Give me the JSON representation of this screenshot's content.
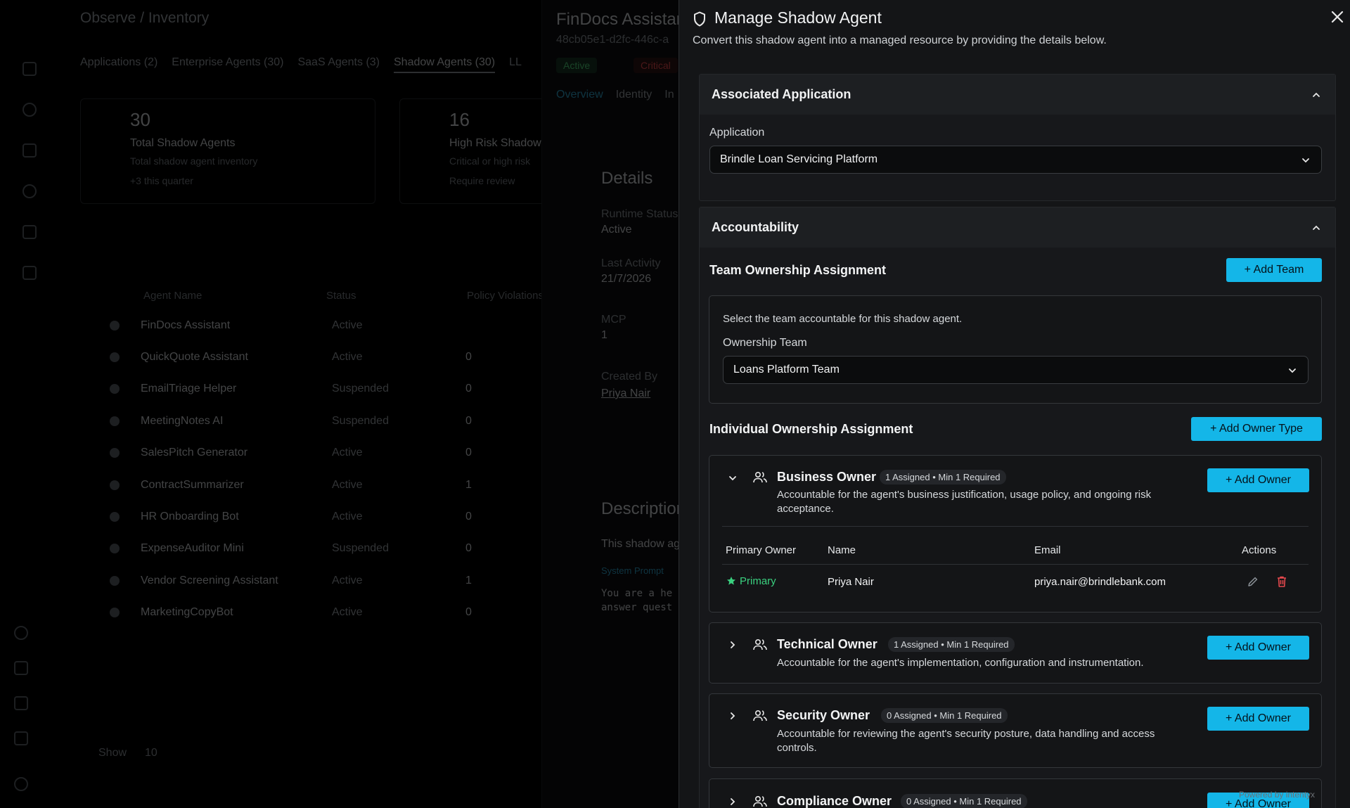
{
  "background": {
    "breadcrumb": "Observe  /  Inventory",
    "tabs": [
      "Applications (2)",
      "Enterprise Agents (30)",
      "SaaS Agents (3)",
      "Shadow Agents (30)",
      "LL"
    ],
    "stats": [
      {
        "value": "30",
        "title": "Total Shadow Agents",
        "line1": "Total shadow agent inventory",
        "line2": "+3 this quarter"
      },
      {
        "value": "16",
        "title": "High Risk Shadow",
        "line1": "Critical or high risk",
        "line2": "Require review"
      }
    ],
    "table_headers": [
      "Agent Name",
      "Status",
      "Policy Violations"
    ],
    "rows": [
      {
        "name": "FinDocs Assistant",
        "status": "Active",
        "count": ""
      },
      {
        "name": "QuickQuote Assistant",
        "status": "Active",
        "count": "0"
      },
      {
        "name": "EmailTriage Helper",
        "status": "Suspended",
        "count": "0"
      },
      {
        "name": "MeetingNotes AI",
        "status": "Suspended",
        "count": "0"
      },
      {
        "name": "SalesPitch Generator",
        "status": "Active",
        "count": "0"
      },
      {
        "name": "ContractSummarizer",
        "status": "Active",
        "count": "1"
      },
      {
        "name": "HR Onboarding Bot",
        "status": "Active",
        "count": "0"
      },
      {
        "name": "ExpenseAuditor Mini",
        "status": "Suspended",
        "count": "0"
      },
      {
        "name": "Vendor Screening Assistant",
        "status": "Active",
        "count": "1"
      },
      {
        "name": "MarketingCopyBot",
        "status": "Active",
        "count": "0"
      }
    ],
    "show_label": "Show",
    "show_value": "10",
    "detail": {
      "title": "FinDocs Assistant",
      "id": "48cb05e1-d2fc-446c-a",
      "status_badge": "Active",
      "risk_badge": "Critical",
      "tabs": [
        "Overview",
        "Identity",
        "In"
      ],
      "section_details": "Details",
      "runtime_label": "Runtime Status",
      "runtime_value": "Active",
      "last_activity_label": "Last Activity",
      "last_activity_value": "21/7/2026",
      "mcp_label": "MCP",
      "mcp_value": "1",
      "created_by_label": "Created By",
      "created_by_value": "Priya Nair",
      "section_description": "Description",
      "description_text": "This shadow ag",
      "system_prompt_label": "System Prompt",
      "prompt_line1": "You are a he",
      "prompt_line2": "answer quest"
    }
  },
  "drawer": {
    "title": "Manage Shadow Agent",
    "subtitle": "Convert this shadow agent into a managed resource by providing the details below.",
    "associated_application": {
      "section_title": "Associated Application",
      "field_label": "Application",
      "selected": "Brindle Loan Servicing Platform"
    },
    "accountability": {
      "section_title": "Accountability",
      "team_title": "Team Ownership Assignment",
      "add_team_label": "+ Add Team",
      "team_hint": "Select the team accountable for this shadow agent.",
      "team_field_label": "Ownership Team",
      "team_selected": "Loans Platform Team",
      "individual_title": "Individual Ownership Assignment",
      "add_owner_type_label": "+ Add Owner Type",
      "owner_types": [
        {
          "name": "Business Owner",
          "pill": "1 Assigned • Min 1 Required",
          "description": "Accountable for the agent's business justification, usage policy, and ongoing risk acceptance.",
          "button": "+ Add Owner",
          "expanded": true
        },
        {
          "name": "Technical Owner",
          "pill": "1 Assigned • Min 1 Required",
          "description": "Accountable for the agent's implementation, configuration and instrumentation.",
          "button": "+ Add Owner",
          "expanded": false
        },
        {
          "name": "Security Owner",
          "pill": "0 Assigned • Min 1 Required",
          "description": "Accountable for reviewing the agent's security posture, data handling and access controls.",
          "button": "+ Add Owner",
          "expanded": false
        },
        {
          "name": "Compliance Owner",
          "pill": "0 Assigned • Min 1 Required",
          "description": "",
          "button": "+ Add Owner",
          "expanded": false
        }
      ],
      "owner_table": {
        "headers": [
          "Primary Owner",
          "Name",
          "Email",
          "Actions"
        ],
        "rows": [
          {
            "primary": "Primary",
            "name": "Priya Nair",
            "email": "priya.nair@brindlebank.com"
          }
        ]
      }
    },
    "footer_brand": "Powered by  intentyx"
  },
  "colors": {
    "accent": "#14b6e8",
    "primary_green": "#3ad07f",
    "delete_red": "#e5484d",
    "panel_bg": "#141517"
  }
}
